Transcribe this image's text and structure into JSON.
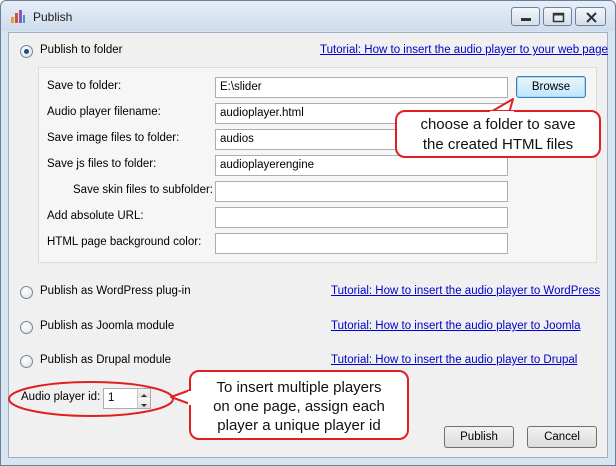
{
  "window": {
    "title": "Publish",
    "icons": {
      "app": "chart-bars-icon",
      "minimize": "minimize-icon",
      "maximize": "maximize-icon",
      "close": "close-icon"
    }
  },
  "options": {
    "folder": {
      "label": "Publish to folder",
      "selected": true,
      "tutorial": "Tutorial: How to insert the audio player to your web page"
    },
    "wordpress": {
      "label": "Publish as WordPress plug-in",
      "selected": false,
      "tutorial": "Tutorial: How to insert the audio player to WordPress"
    },
    "joomla": {
      "label": "Publish as Joomla module",
      "selected": false,
      "tutorial": "Tutorial: How to insert the audio player to Joomla"
    },
    "drupal": {
      "label": "Publish as Drupal module",
      "selected": false,
      "tutorial": "Tutorial: How to insert the audio player to Drupal"
    }
  },
  "folder_settings": {
    "save_to_folder": {
      "label": "Save to folder:",
      "value": "E:\\slider"
    },
    "browse_label": "Browse",
    "audio_filename": {
      "label": "Audio player filename:",
      "value": "audioplayer.html"
    },
    "image_folder": {
      "label": "Save image files to folder:",
      "value": "audios"
    },
    "js_folder": {
      "label": "Save js files to folder:",
      "value": "audioplayerengine"
    },
    "skin_subfolder": {
      "label": "Save skin files to subfolder:",
      "value": ""
    },
    "absolute_url": {
      "label": "Add absolute URL:",
      "value": ""
    },
    "bg_color": {
      "label": "HTML page background color:",
      "value": ""
    }
  },
  "player_id": {
    "label": "Audio player id:",
    "value": "1"
  },
  "buttons": {
    "publish": "Publish",
    "cancel": "Cancel"
  },
  "callouts": {
    "browse_tip": [
      "choose a folder to save",
      "the created HTML files"
    ],
    "player_id_tip": [
      "To insert multiple players",
      "on one page, assign each",
      "player a unique player id"
    ]
  },
  "colors": {
    "annotation": "#e02020",
    "link": "#0000cc",
    "titlebar": "#d7e4f2"
  }
}
